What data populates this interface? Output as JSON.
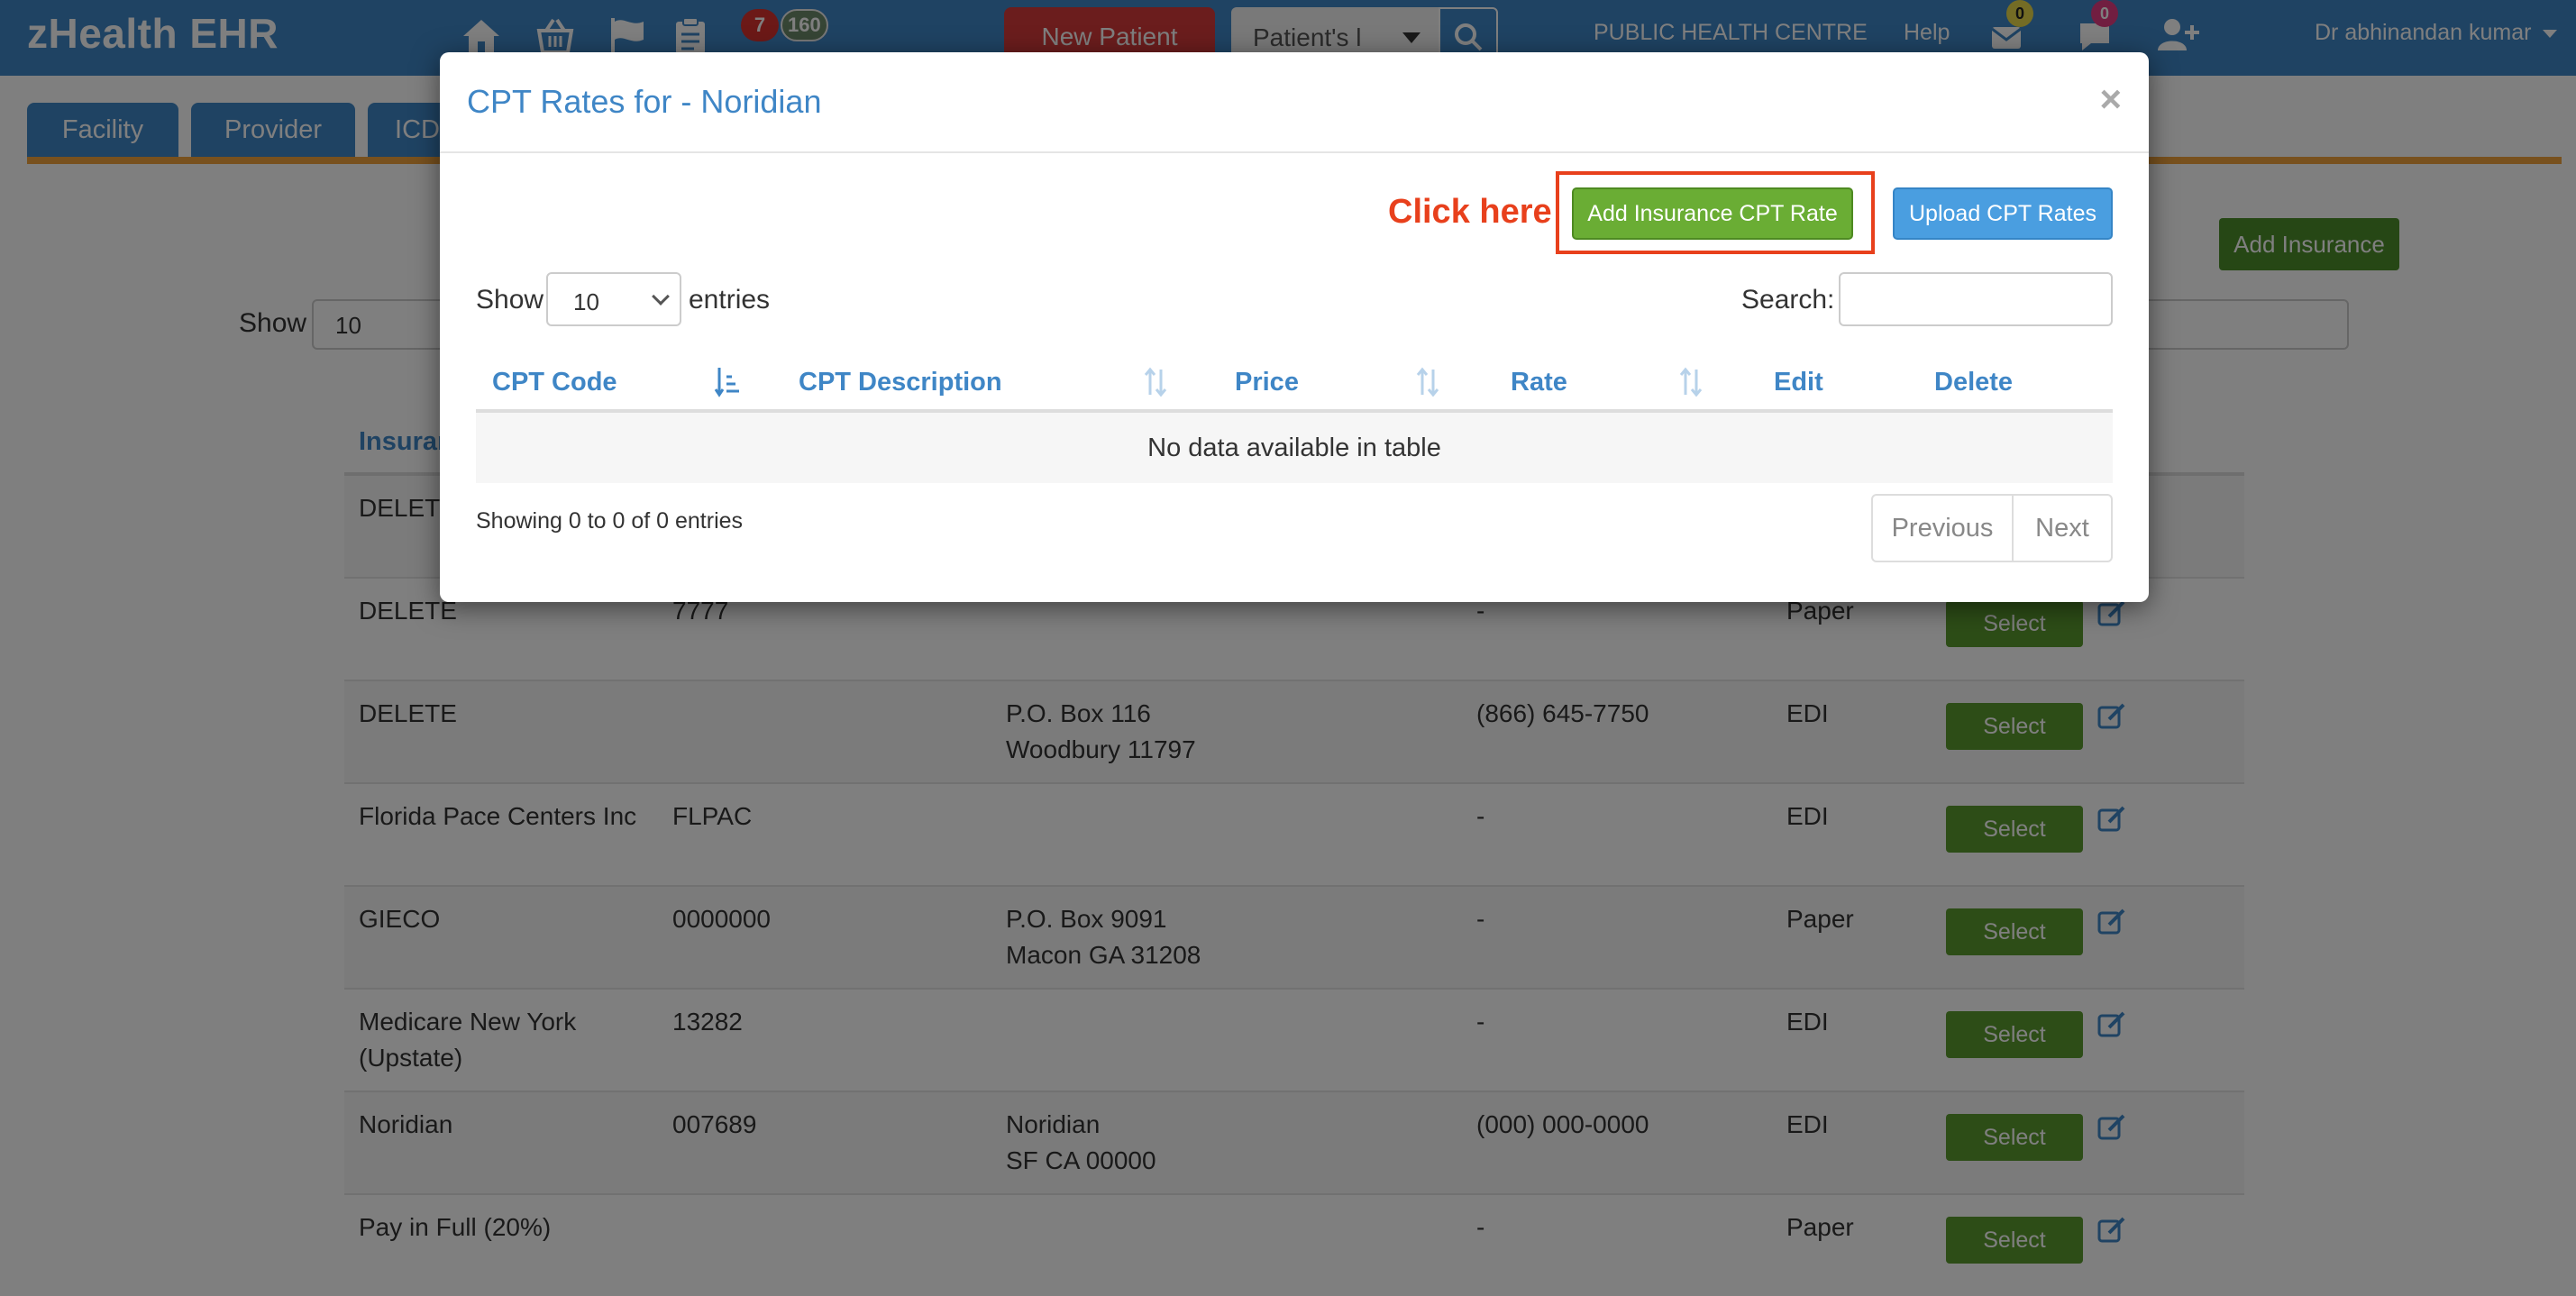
{
  "app": {
    "brand": "zHealth EHR"
  },
  "navbar": {
    "badges": {
      "red": "7",
      "gray": "160"
    },
    "new_patient_label": "New Patient",
    "patient_search_value": "Patient's l",
    "facility": "PUBLIC HEALTH CENTRE",
    "help": "Help",
    "mail_count": "0",
    "chat_count": "0",
    "user": "Dr abhinandan kumar"
  },
  "background_page": {
    "tabs": [
      "Facility",
      "Provider",
      "ICD"
    ],
    "add_insurance_label": "Add Insurance",
    "show_label": "Show",
    "show_value": "10",
    "table_header_first": "Insurar",
    "rows": [
      {
        "name": "DELETE",
        "code": "",
        "address": [
          "",
          ""
        ],
        "phone": "",
        "type": ""
      },
      {
        "name": "DELETE",
        "code": "7777",
        "address": [
          "",
          ""
        ],
        "phone": "-",
        "type": "Paper"
      },
      {
        "name": "DELETE",
        "code": "",
        "address": [
          "P.O. Box 116",
          "Woodbury  11797"
        ],
        "phone": "(866) 645-7750",
        "type": "EDI"
      },
      {
        "name": "Florida Pace Centers Inc",
        "code": "FLPAC",
        "address": [
          "",
          ""
        ],
        "phone": "-",
        "type": "EDI"
      },
      {
        "name": "GIECO",
        "code": "0000000",
        "address": [
          "P.O. Box 9091",
          "Macon GA 31208"
        ],
        "phone": "-",
        "type": "Paper"
      },
      {
        "name": "Medicare New York (Upstate)",
        "code": "13282",
        "address": [
          "",
          ""
        ],
        "phone": "-",
        "type": "EDI"
      },
      {
        "name": "Noridian",
        "code": "007689",
        "address": [
          "Noridian",
          "SF CA 00000"
        ],
        "phone": "(000) 000-0000",
        "type": "EDI"
      },
      {
        "name": "Pay in Full (20%)",
        "code": "",
        "address": [
          "",
          ""
        ],
        "phone": "-",
        "type": "Paper"
      }
    ],
    "select_label": "Select"
  },
  "modal": {
    "title": "CPT Rates for - Noridian",
    "close": "×",
    "annotation": "Click here",
    "add_cpt_label": "Add Insurance CPT Rate",
    "upload_label": "Upload CPT Rates",
    "show_label": "Show",
    "show_value": "10",
    "entries_label": "entries",
    "search_label": "Search:",
    "columns": [
      "CPT Code",
      "CPT Description",
      "Price",
      "Rate",
      "Edit",
      "Delete"
    ],
    "empty_message": "No data available in table",
    "info": "Showing 0 to 0 of 0 entries",
    "prev_label": "Previous",
    "next_label": "Next"
  },
  "colors": {
    "navbar": "#3f86c6",
    "accent_orange": "#f0a33c",
    "annotation_red": "#e8401c",
    "add_green": "#6aad34",
    "upload_blue": "#4a9ee0"
  }
}
